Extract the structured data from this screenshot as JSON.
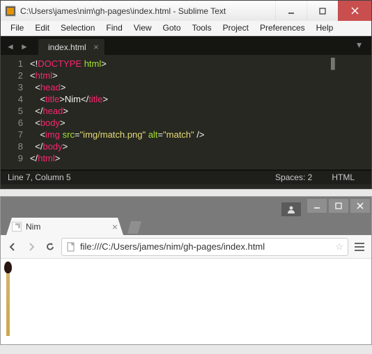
{
  "sublime": {
    "title": "C:\\Users\\james\\nim\\gh-pages\\index.html - Sublime Text",
    "menu": [
      "File",
      "Edit",
      "Selection",
      "Find",
      "View",
      "Goto",
      "Tools",
      "Project",
      "Preferences",
      "Help"
    ],
    "tab": {
      "label": "index.html"
    },
    "lines": [
      {
        "n": "1",
        "html": "<span class='br'>&lt;!</span><span class='tag'>DOCTYPE</span> <span class='attr'>html</span><span class='br'>&gt;</span>"
      },
      {
        "n": "2",
        "html": "<span class='br'>&lt;</span><span class='tag'>html</span><span class='br'>&gt;</span>"
      },
      {
        "n": "3",
        "html": "  <span class='br'>&lt;</span><span class='tag'>head</span><span class='br'>&gt;</span>"
      },
      {
        "n": "4",
        "html": "    <span class='br'>&lt;</span><span class='tag'>title</span><span class='br'>&gt;</span><span class='txt'>Nim</span><span class='br'>&lt;/</span><span class='tag'>title</span><span class='br'>&gt;</span>"
      },
      {
        "n": "5",
        "html": "  <span class='br'>&lt;/</span><span class='tag'>head</span><span class='br'>&gt;</span>"
      },
      {
        "n": "6",
        "html": "  <span class='br'>&lt;</span><span class='tag'>body</span><span class='br'>&gt;</span>"
      },
      {
        "n": "7",
        "html": "    <span class='br'>&lt;</span><span class='tag'>img</span> <span class='attr'>src</span><span class='br'>=</span><span class='str'>\"img/match.png\"</span> <span class='attr'>alt</span><span class='br'>=</span><span class='str'>\"match\"</span> <span class='br'>/&gt;</span>"
      },
      {
        "n": "8",
        "html": "  <span class='br'>&lt;/</span><span class='tag'>body</span><span class='br'>&gt;</span>"
      },
      {
        "n": "9",
        "html": "<span class='br'>&lt;/</span><span class='tag'>html</span><span class='br'>&gt;</span>"
      }
    ],
    "status": {
      "pos": "Line 7, Column 5",
      "spaces": "Spaces: 2",
      "syntax": "HTML"
    }
  },
  "chrome": {
    "tab_title": "Nim",
    "url": "file:///C:/Users/james/nim/gh-pages/index.html"
  }
}
